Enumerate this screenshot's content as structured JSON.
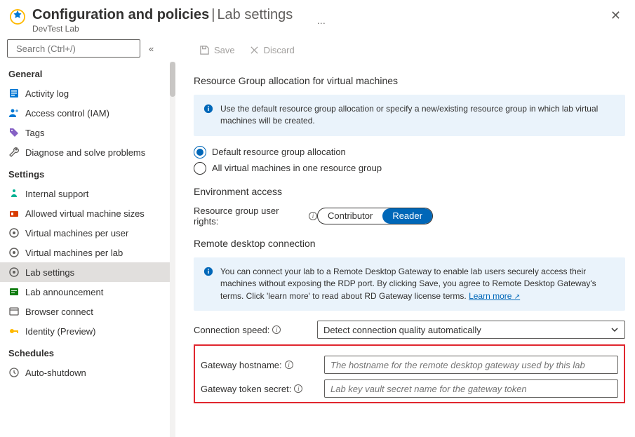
{
  "header": {
    "title_main": "Configuration and policies",
    "title_tail": "Lab settings",
    "subtitle": "DevTest Lab"
  },
  "search": {
    "placeholder": "Search (Ctrl+/)"
  },
  "sidebar": {
    "groups": [
      {
        "label": "General"
      },
      {
        "label": "Settings"
      },
      {
        "label": "Schedules"
      }
    ],
    "items_general": [
      {
        "label": "Activity log"
      },
      {
        "label": "Access control (IAM)"
      },
      {
        "label": "Tags"
      },
      {
        "label": "Diagnose and solve problems"
      }
    ],
    "items_settings": [
      {
        "label": "Internal support"
      },
      {
        "label": "Allowed virtual machine sizes"
      },
      {
        "label": "Virtual machines per user"
      },
      {
        "label": "Virtual machines per lab"
      },
      {
        "label": "Lab settings"
      },
      {
        "label": "Lab announcement"
      },
      {
        "label": "Browser connect"
      },
      {
        "label": "Identity (Preview)"
      }
    ],
    "items_schedules": [
      {
        "label": "Auto-shutdown"
      }
    ]
  },
  "toolbar": {
    "save": "Save",
    "discard": "Discard"
  },
  "main": {
    "rg_section": "Resource Group allocation for virtual machines",
    "rg_info": "Use the default resource group allocation or specify a new/existing resource group in which lab virtual machines will be created.",
    "rg_opt1": "Default resource group allocation",
    "rg_opt2": "All virtual machines in one resource group",
    "env_section": "Environment access",
    "env_label": "Resource group user rights:",
    "env_opt1": "Contributor",
    "env_opt2": "Reader",
    "rdp_section": "Remote desktop connection",
    "rdp_info": "You can connect your lab to a Remote Desktop Gateway to enable lab users securely access their machines without exposing the RDP port. By clicking Save, you agree to Remote Desktop Gateway's terms.  Click 'learn more' to read about RD Gateway license terms.",
    "learn_more": "Learn more",
    "conn_speed_label": "Connection speed:",
    "conn_speed_value": "Detect connection quality automatically",
    "gw_host_label": "Gateway hostname:",
    "gw_host_placeholder": "The hostname for the remote desktop gateway used by this lab",
    "gw_secret_label": "Gateway token secret:",
    "gw_secret_placeholder": "Lab key vault secret name for the gateway token"
  }
}
